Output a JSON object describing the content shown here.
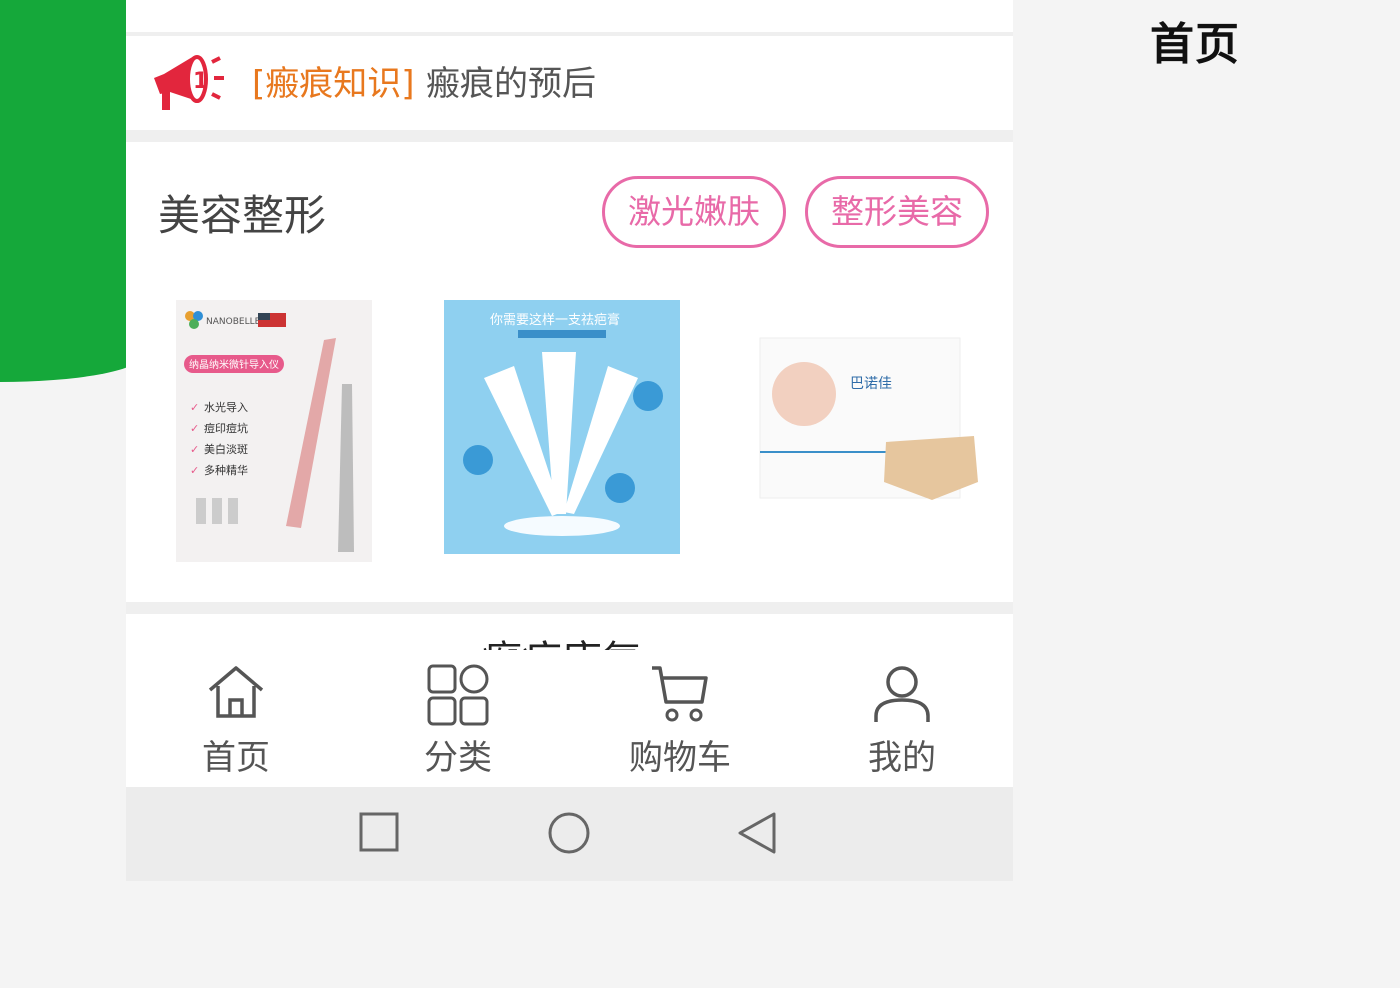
{
  "caption": "首页",
  "notice": {
    "tag": "[瘢痕知识]",
    "message": "瘢痕的预后",
    "icon": "megaphone-icon"
  },
  "section": {
    "title": "美容整形",
    "pills": [
      "激光嫩肤",
      "整形美容"
    ],
    "products": [
      {
        "brand": "NANOBELLE",
        "badge": "纳晶纳米微针导入仪",
        "features": [
          "水光导入",
          "痘印痘坑",
          "美白淡斑",
          "多种精华"
        ]
      },
      {
        "headline": "你需要这样一支祛疤膏"
      },
      {
        "brand": "巴诺佳"
      }
    ]
  },
  "next_section": {
    "partial_title": "瘢痕康复"
  },
  "tabbar": {
    "items": [
      {
        "label": "首页",
        "icon": "home-icon"
      },
      {
        "label": "分类",
        "icon": "category-icon"
      },
      {
        "label": "购物车",
        "icon": "cart-icon"
      },
      {
        "label": "我的",
        "icon": "profile-icon"
      }
    ]
  },
  "system_nav": [
    "recent-apps-icon",
    "home-circle-icon",
    "back-triangle-icon"
  ],
  "colors": {
    "green": "#15a83a",
    "accent_pink": "#e86aa8",
    "tag_orange": "#e8781e",
    "megaphone_red": "#e2263d"
  }
}
